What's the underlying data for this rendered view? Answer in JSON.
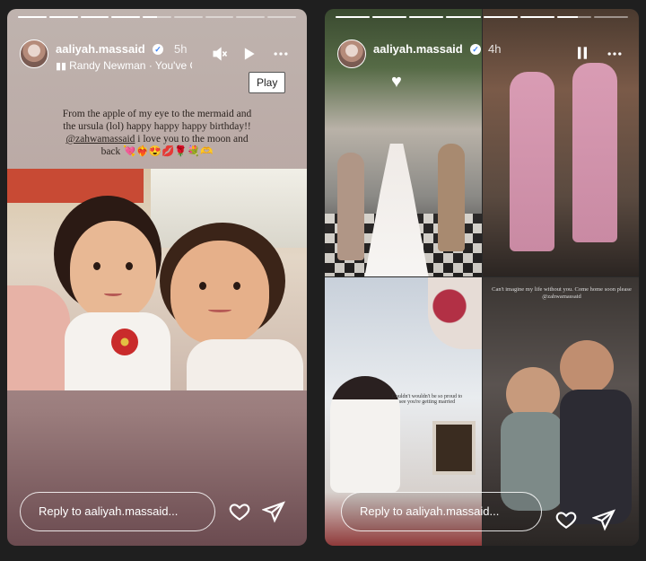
{
  "left_story": {
    "username": "aaliyah.massaid",
    "time": "5h",
    "music": "Randy Newman · You've G",
    "tooltip": "Play",
    "caption": {
      "line1": "From the apple of my eye to the mermaid and",
      "line2": "the ursula (lol) happy happy happy birthday!!",
      "mention": "@zahwamassaid",
      "line3_suffix": " i love you to the moon and",
      "line4": "back 💘❤️‍🔥😍💋🌹💐🫶"
    },
    "reply_placeholder": "Reply to aaliyah.massaid...",
    "progress": [
      1,
      1,
      1,
      1,
      0.5,
      0,
      0,
      0,
      0
    ]
  },
  "right_story": {
    "username": "aaliyah.massaid",
    "time": "4h",
    "reply_placeholder": "Reply to aaliyah.massaid...",
    "photo_text_1": "Couldn't wouldn't be so proud to see you're getting married",
    "photo_text_2": "Can't imagine my life without you. Come home soon please @zahwamassaid",
    "progress": [
      1,
      1,
      1,
      1,
      1,
      1,
      0.6,
      0
    ]
  },
  "colors": {
    "verified_blue": "#3b82f6",
    "left_bg_top": "#bfb3ae",
    "left_bg_bottom": "#6b4b50"
  },
  "icons": {
    "verified": "verified-badge-icon",
    "mute": "speaker-muted-icon",
    "play": "play-icon",
    "pause": "pause-icon",
    "more": "more-horizontal-icon",
    "like": "heart-icon",
    "share": "paper-plane-icon",
    "music": "music-bars-icon"
  }
}
